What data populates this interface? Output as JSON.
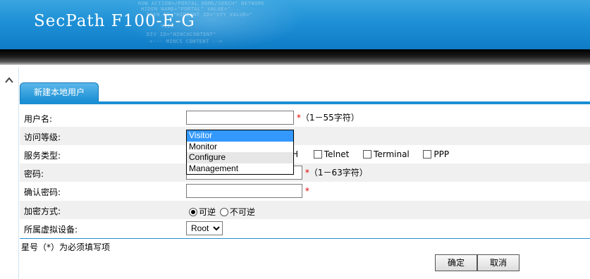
{
  "header": {
    "brand": "SecPath F100-E-G",
    "code_lines": [
      "ROW ACTION=/PORTAL HOME/SERCH\" NETWORK",
      "HIDEN NAME=\"PORTAL\" VALUE=\"",
      "RDEN ID=\"HIDDENT ID=\"STY VALUE=\"",
      "VIEW",
      "DIV ID=\"NINCHCONTENT\"",
      "<--- MINCS CONTENT -->"
    ]
  },
  "tab": {
    "label": "新建本地用户"
  },
  "form": {
    "username": {
      "label": "用户名:",
      "value": "",
      "required_mark": "*",
      "hint": "（1－55字符）"
    },
    "access_level": {
      "label": "访问等级:",
      "options": [
        "Visitor",
        "Monitor",
        "Configure",
        "Management"
      ],
      "selected": "Visitor",
      "hovered": "Configure"
    },
    "service_type": {
      "label": "服务类型:",
      "partial_text": "H",
      "options": [
        "Telnet",
        "Terminal",
        "PPP"
      ]
    },
    "password": {
      "label": "密码:",
      "value": "",
      "required_mark": "*",
      "hint": "（1－63字符）"
    },
    "confirm_password": {
      "label": "确认密码:",
      "value": "",
      "required_mark": "*"
    },
    "encryption": {
      "label": "加密方式:",
      "options": [
        "可逆",
        "不可逆"
      ],
      "selected": "可逆"
    },
    "virtual_device": {
      "label": "所属虚拟设备:",
      "value": "Root"
    }
  },
  "note": "星号（*）为必须填写项",
  "buttons": {
    "ok": "确定",
    "cancel": "取消"
  }
}
